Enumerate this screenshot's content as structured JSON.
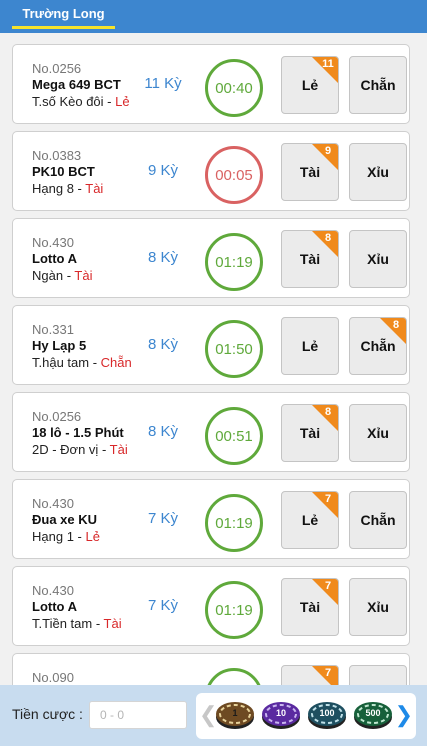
{
  "header": {
    "tab_label": "Trường Long"
  },
  "rows": [
    {
      "no": "No.0256",
      "name": "Mega 649 BCT",
      "sub_label": "T.số Kèo đôi",
      "sub_result": "Lẻ",
      "ky": "11 Kỳ",
      "timer": "00:40",
      "timer_state": "green",
      "bet1": {
        "label": "Lẻ",
        "badge": "11"
      },
      "bet2": {
        "label": "Chẵn",
        "badge": ""
      }
    },
    {
      "no": "No.0383",
      "name": "PK10 BCT",
      "sub_label": "Hạng 8",
      "sub_result": "Tài",
      "ky": "9 Kỳ",
      "timer": "00:05",
      "timer_state": "red",
      "bet1": {
        "label": "Tài",
        "badge": "9"
      },
      "bet2": {
        "label": "Xỉu",
        "badge": ""
      }
    },
    {
      "no": "No.430",
      "name": "Lotto A",
      "sub_label": "Ngàn",
      "sub_result": "Tài",
      "ky": "8 Kỳ",
      "timer": "01:19",
      "timer_state": "green",
      "bet1": {
        "label": "Tài",
        "badge": "8"
      },
      "bet2": {
        "label": "Xỉu",
        "badge": ""
      }
    },
    {
      "no": "No.331",
      "name": "Hy Lạp 5",
      "sub_label": "T.hậu tam",
      "sub_result": "Chẵn",
      "ky": "8 Kỳ",
      "timer": "01:50",
      "timer_state": "green",
      "bet1": {
        "label": "Lẻ",
        "badge": ""
      },
      "bet2": {
        "label": "Chẵn",
        "badge": "8"
      }
    },
    {
      "no": "No.0256",
      "name": "18 lô - 1.5 Phút",
      "sub_label": "2D - Đơn vị",
      "sub_result": "Tài",
      "ky": "8 Kỳ",
      "timer": "00:51",
      "timer_state": "green",
      "bet1": {
        "label": "Tài",
        "badge": "8"
      },
      "bet2": {
        "label": "Xỉu",
        "badge": ""
      }
    },
    {
      "no": "No.430",
      "name": "Đua xe KU",
      "sub_label": "Hạng 1",
      "sub_result": "Lẻ",
      "ky": "7 Kỳ",
      "timer": "01:19",
      "timer_state": "green",
      "bet1": {
        "label": "Lẻ",
        "badge": "7"
      },
      "bet2": {
        "label": "Chẵn",
        "badge": ""
      }
    },
    {
      "no": "No.430",
      "name": "Lotto A",
      "sub_label": "T.Tiền tam",
      "sub_result": "Tài",
      "ky": "7 Kỳ",
      "timer": "01:19",
      "timer_state": "green",
      "bet1": {
        "label": "Tài",
        "badge": "7"
      },
      "bet2": {
        "label": "Xỉu",
        "badge": ""
      }
    },
    {
      "no": "No.090",
      "name": "",
      "sub_label": "",
      "sub_result": "",
      "ky": "",
      "timer": "",
      "timer_state": "green",
      "bet1": {
        "label": "",
        "badge": "7"
      },
      "bet2": {
        "label": "",
        "badge": ""
      }
    }
  ],
  "footer": {
    "label": "Tiền cược :",
    "input_placeholder": "0 - 0",
    "left_arrow_icon": "chevron-left-icon",
    "right_arrow_icon": "chevron-right-icon",
    "chips": [
      {
        "value": "1",
        "color": "#6e4a22",
        "rim": "#e7d29a",
        "text_color": "#1a1a1a"
      },
      {
        "value": "10",
        "color": "#5a2aa0",
        "rim": "#c9b6ef",
        "text_color": "#ffffff"
      },
      {
        "value": "100",
        "color": "#1e4f60",
        "rim": "#bfe0e8",
        "text_color": "#ffffff"
      },
      {
        "value": "500",
        "color": "#17603a",
        "rim": "#bfe6cf",
        "text_color": "#ffffff"
      }
    ]
  },
  "colors": {
    "header_bg": "#3d86cf",
    "tab_underline": "#f6e32b",
    "timer_green": "#5fa93b",
    "timer_red": "#d96262",
    "ky_blue": "#3d86cf",
    "result_red": "#d8282a",
    "badge_orange": "#f08a1c",
    "footer_bg": "#c8dcef"
  }
}
